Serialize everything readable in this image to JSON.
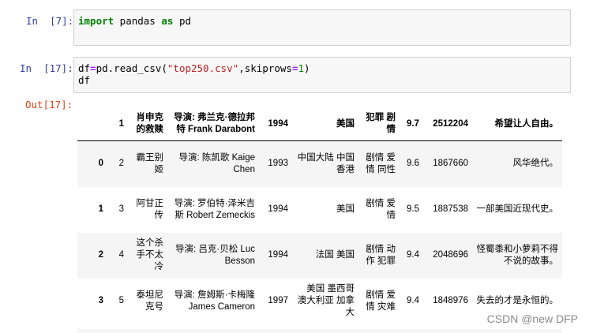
{
  "cells": [
    {
      "prompt": "In  [7]:",
      "code_tokens": [
        {
          "text": "import",
          "cls": "kw"
        },
        {
          "text": " pandas ",
          "cls": ""
        },
        {
          "text": "as",
          "cls": "kw"
        },
        {
          "text": " pd",
          "cls": ""
        }
      ]
    },
    {
      "prompt": "In  [17]:",
      "line1_tokens": [
        {
          "text": "df",
          "cls": ""
        },
        {
          "text": "=",
          "cls": "op"
        },
        {
          "text": "pd.read_csv(",
          "cls": ""
        },
        {
          "text": "\"top250.csv\"",
          "cls": "str"
        },
        {
          "text": ",skiprows",
          "cls": ""
        },
        {
          "text": "=",
          "cls": "op"
        },
        {
          "text": "1",
          "cls": "num"
        },
        {
          "text": ")",
          "cls": ""
        }
      ],
      "line2": "df"
    }
  ],
  "output_prompt": "Out[17]:",
  "dataframe": {
    "columns": [
      "",
      "1",
      "肖申克的救赎",
      "导演: 弗兰克·德拉邦特 Frank Darabont",
      "1994",
      "美国",
      "犯罪 剧情",
      "9.7",
      "2512204",
      "希望让人自由。"
    ],
    "rows": [
      [
        "0",
        "2",
        "霸王别姬",
        "导演: 陈凯歌 Kaige Chen",
        "1993",
        "中国大陆 中国香港",
        "剧情 爱情 同性",
        "9.6",
        "1867660",
        "风华绝代。"
      ],
      [
        "1",
        "3",
        "阿甘正传",
        "导演: 罗伯特·泽米吉斯 Robert Zemeckis",
        "1994",
        "美国",
        "剧情 爱情",
        "9.5",
        "1887538",
        "一部美国近现代史。"
      ],
      [
        "2",
        "4",
        "这个杀手不太冷",
        "导演: 吕克·贝松 Luc Besson",
        "1994",
        "法国 美国",
        "剧情 动作 犯罪",
        "9.4",
        "2048696",
        "怪蜀黍和小萝莉不得不说的故事。"
      ],
      [
        "3",
        "5",
        "泰坦尼克号",
        "导演: 詹姆斯·卡梅隆 James Cameron",
        "1997",
        "美国 墨西哥 澳大利亚 加拿大",
        "剧情 爱情 灾难",
        "9.4",
        "1848976",
        "失去的才是永恒的。"
      ]
    ]
  },
  "watermark": "CSDN @new DFP"
}
